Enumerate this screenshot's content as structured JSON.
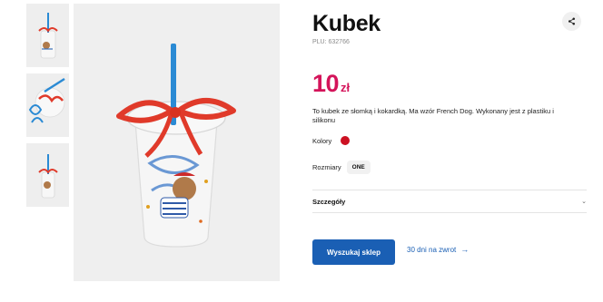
{
  "product": {
    "title": "Kubek",
    "plu": "PLU: 632766",
    "price_value": "10",
    "price_currency": "zł",
    "description": "To kubek ze słomką i kokardką. Ma wzór French Dog. Wykonany jest z plastiku i silikonu",
    "colors_label": "Kolory",
    "color_hex": "#cc1122",
    "sizes_label": "Rozmiary",
    "size_value": "ONE",
    "details_label": "Szczegóły",
    "details_icon": "chevron-down-icon",
    "share_icon": "share-icon"
  },
  "actions": {
    "find_store_label": "Wyszukaj sklep",
    "returns_label": "30 dni na zwrot",
    "returns_icon": "arrow-right-icon"
  },
  "colors": {
    "accent": "#d4145a",
    "primary": "#1a5fb4"
  }
}
